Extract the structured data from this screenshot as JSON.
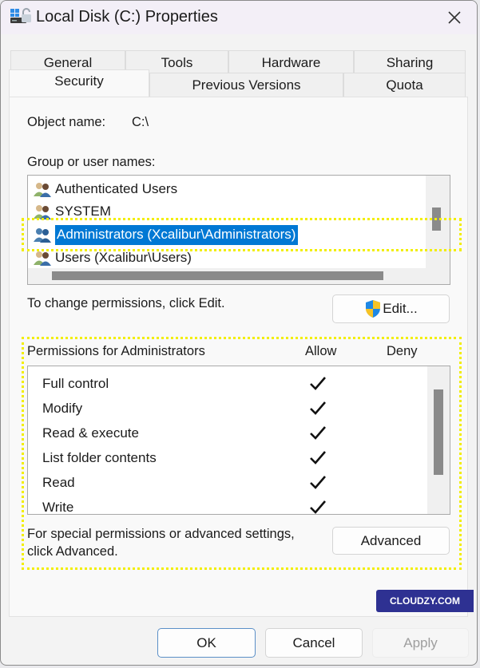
{
  "window": {
    "title": "Local Disk (C:) Properties",
    "app_icon": "drive-properties-icon",
    "close_icon": "close-icon"
  },
  "tabs": {
    "row1": [
      "General",
      "Tools",
      "Hardware",
      "Sharing"
    ],
    "row2": [
      "Security",
      "Previous Versions",
      "Quota"
    ],
    "active": "Security"
  },
  "security": {
    "object_name_label": "Object name:",
    "object_name_value": "C:\\",
    "group_label": "Group or user names:",
    "users": [
      {
        "name": "Authenticated Users",
        "selected": false
      },
      {
        "name": "SYSTEM",
        "selected": false
      },
      {
        "name": "Administrators (Xcalibur\\Administrators)",
        "selected": true
      },
      {
        "name": "Users (Xcalibur\\Users)",
        "selected": false
      }
    ],
    "change_hint": "To change permissions, click Edit.",
    "edit_button": "Edit...",
    "permissions_label": "Permissions for Administrators",
    "allow_header": "Allow",
    "deny_header": "Deny",
    "permissions": [
      {
        "name": "Full control",
        "allow": true,
        "deny": false
      },
      {
        "name": "Modify",
        "allow": true,
        "deny": false
      },
      {
        "name": "Read & execute",
        "allow": true,
        "deny": false
      },
      {
        "name": "List folder contents",
        "allow": true,
        "deny": false
      },
      {
        "name": "Read",
        "allow": true,
        "deny": false
      },
      {
        "name": "Write",
        "allow": true,
        "deny": false
      }
    ],
    "advanced_hint_line1": "For special permissions or advanced settings,",
    "advanced_hint_line2": "click Advanced.",
    "advanced_button": "Advanced"
  },
  "footer": {
    "ok": "OK",
    "cancel": "Cancel",
    "apply": "Apply"
  },
  "watermark": "CLOUDZY.COM",
  "colors": {
    "selection": "#0078d4",
    "highlight": "#f2ee00",
    "watermark_bg": "#2e3192"
  }
}
